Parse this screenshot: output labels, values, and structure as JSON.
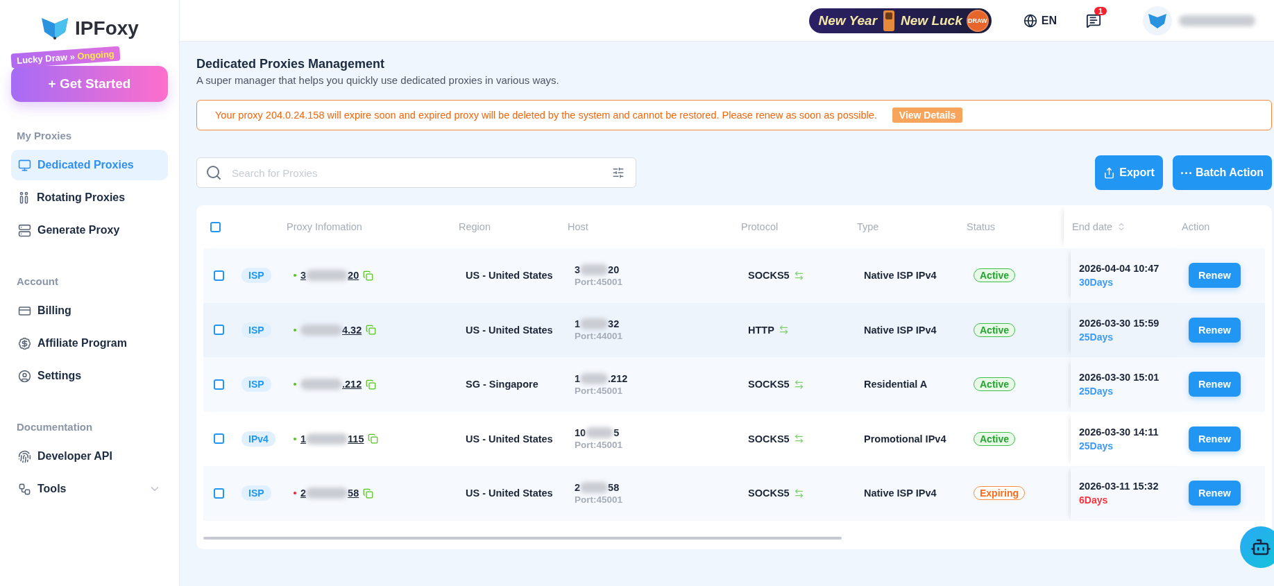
{
  "brand": {
    "name": "IPFoxy"
  },
  "promo": {
    "ribbon": "Lucky Draw »",
    "ribbon_status": "Ongoing",
    "button": "+ Get Started"
  },
  "sidebar": {
    "sections": [
      {
        "title": "My Proxies",
        "items": [
          {
            "label": "Dedicated Proxies",
            "selected": true
          },
          {
            "label": "Rotating Proxies",
            "selected": false
          },
          {
            "label": "Generate Proxy",
            "selected": false
          }
        ]
      },
      {
        "title": "Account",
        "items": [
          {
            "label": "Billing",
            "selected": false
          },
          {
            "label": "Affiliate Program",
            "selected": false
          },
          {
            "label": "Settings",
            "selected": false
          }
        ]
      },
      {
        "title": "Documentation",
        "items": [
          {
            "label": "Developer API",
            "selected": false
          },
          {
            "label": "Tools",
            "selected": false,
            "expanded": false
          }
        ]
      }
    ]
  },
  "header": {
    "banner": {
      "left": "New Year",
      "right": "New Luck",
      "badge": "DRAW"
    },
    "language": "EN",
    "notifications": "1"
  },
  "page": {
    "title": "Dedicated Proxies Management",
    "subtitle": "A super manager that helps you quickly use dedicated proxies in various ways."
  },
  "alert": {
    "message": "Your proxy 204.0.24.158 will expire soon and expired proxy will be deleted by the system and cannot be restored. Please renew as soon as possible.",
    "action": "View Details"
  },
  "search": {
    "placeholder": "Search for Proxies"
  },
  "actions": [
    {
      "label": "Export"
    },
    {
      "label": "Batch Action"
    }
  ],
  "table": {
    "select_all_checked": false,
    "columns": [
      "Proxy Infomation",
      "Region",
      "Host",
      "Protocol",
      "Type",
      "Status",
      "End date",
      "Action"
    ],
    "rows": [
      {
        "checked": false,
        "tag": "ISP",
        "color": "#52c41a",
        "ip_start": "3",
        "ip_end": "20",
        "region": "US - United States",
        "host_start": "3",
        "host_end": "20",
        "port": "Port:45001",
        "protocol": "SOCKS5",
        "type": "Native ISP IPv4",
        "status": "Active",
        "kind": "active",
        "end_date": "2026-04-04 10:47",
        "days": "30Days",
        "action": "Renew"
      },
      {
        "checked": false,
        "tag": "ISP",
        "color": "#52c41a",
        "ip_start": "",
        "ip_end": "4.32",
        "region": "US - United States",
        "host_start": "1",
        "host_end": "32",
        "port": "Port:44001",
        "protocol": "HTTP",
        "type": "Native ISP IPv4",
        "status": "Active",
        "kind": "active",
        "end_date": "2026-03-30 15:59",
        "days": "25Days",
        "action": "Renew"
      },
      {
        "checked": false,
        "tag": "ISP",
        "color": "#52c41a",
        "ip_start": "",
        "ip_end": ".212",
        "region": "SG - Singapore",
        "host_start": "1",
        "host_end": ".212",
        "port": "Port:45001",
        "protocol": "SOCKS5",
        "type": "Residential A",
        "status": "Active",
        "kind": "active",
        "end_date": "2026-03-30 15:01",
        "days": "25Days",
        "action": "Renew"
      },
      {
        "checked": false,
        "tag": "IPv4",
        "color": "#52c41a",
        "ip_start": "1",
        "ip_end": "115",
        "region": "US - United States",
        "host_start": "10",
        "host_end": "5",
        "port": "Port:45001",
        "protocol": "SOCKS5",
        "type": "Promotional IPv4",
        "status": "Active",
        "kind": "active",
        "end_date": "2026-03-30 14:11",
        "days": "25Days",
        "action": "Renew"
      },
      {
        "checked": false,
        "tag": "ISP",
        "color": "#f5222d",
        "ip_start": "2",
        "ip_end": "58",
        "region": "US - United States",
        "host_start": "2",
        "host_end": "58",
        "port": "Port:45001",
        "protocol": "SOCKS5",
        "type": "Native ISP IPv4",
        "status": "Expiring",
        "kind": "expiring",
        "end_date": "2026-03-11 15:32",
        "days": "6Days",
        "action": "Renew"
      }
    ]
  }
}
